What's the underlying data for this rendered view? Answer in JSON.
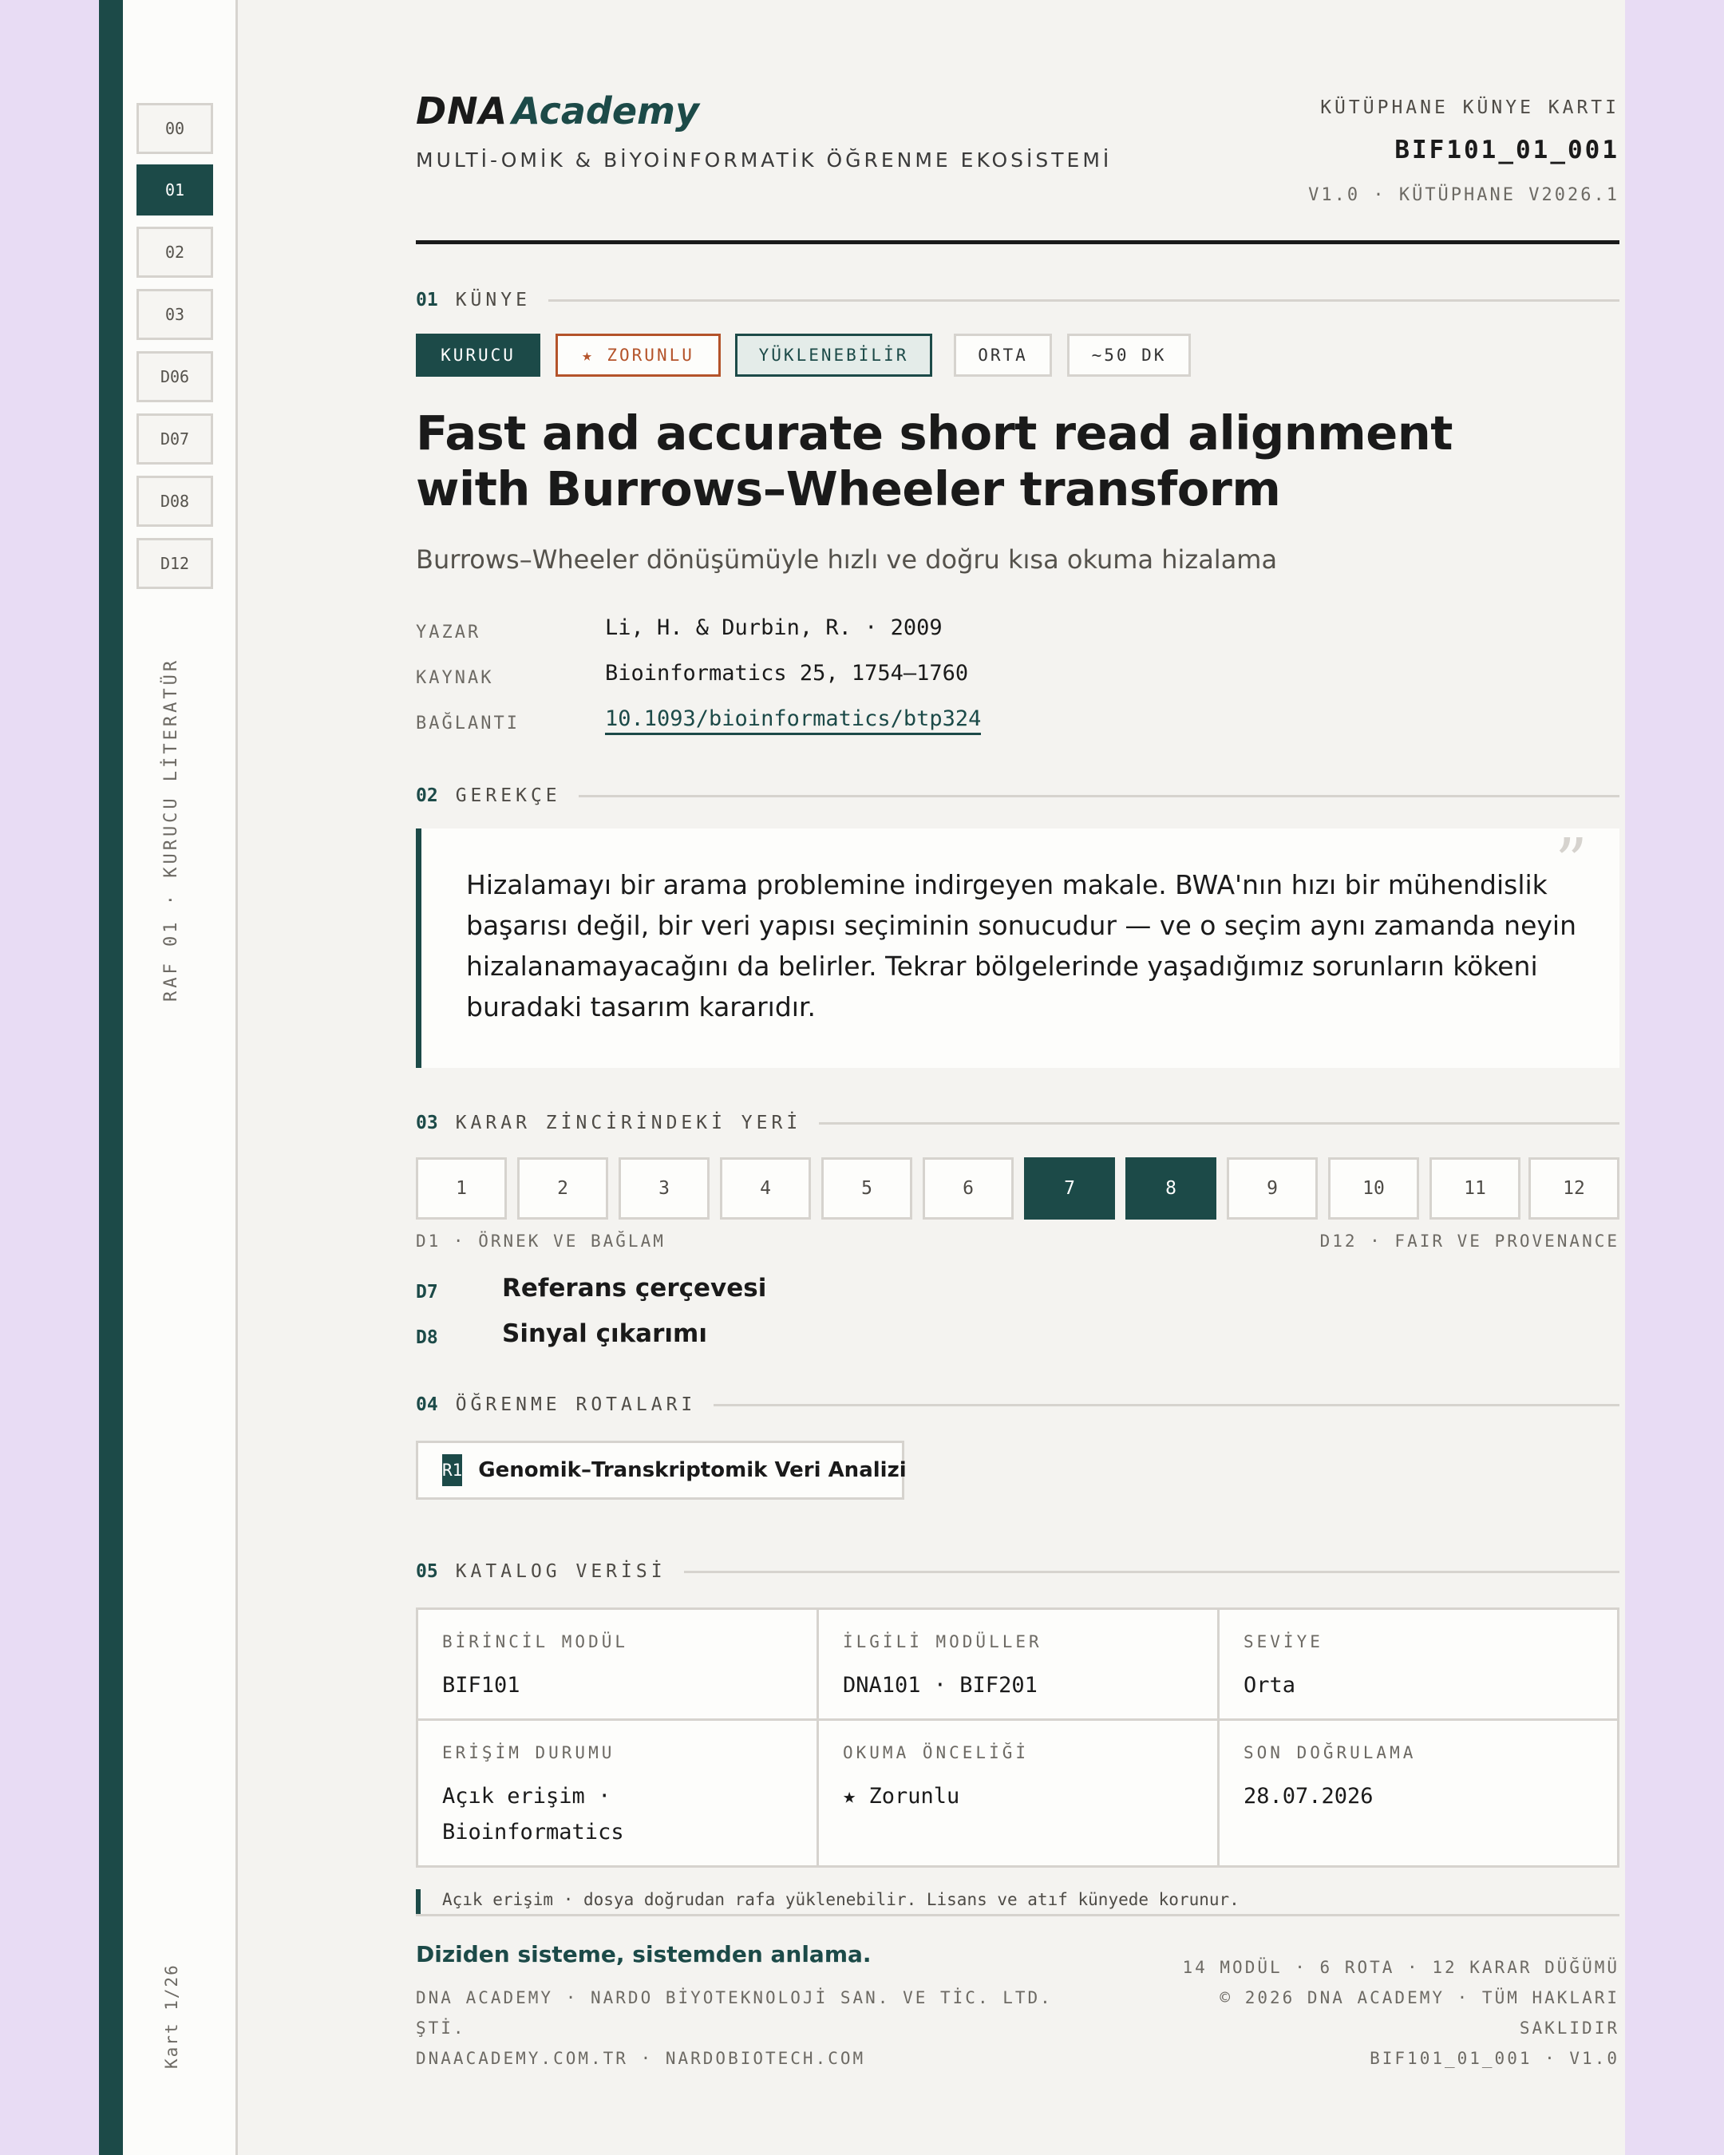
{
  "rail": {
    "items": [
      "00",
      "01",
      "02",
      "03",
      "D06",
      "D07",
      "D08",
      "D12"
    ],
    "active_index": 1,
    "shelf_label": "RAF 01 · KURUCU LİTERATÜR",
    "card_label": "Kart 1/26"
  },
  "header": {
    "brand_dna": "DNA",
    "brand_academy": "Academy",
    "tagline": "MULTİ-OMİK & BİYOİNFORMATİK ÖĞRENME EKOSİSTEMİ",
    "card_type": "KÜTÜPHANE KÜNYE KARTI",
    "card_id": "BIF101_01_001",
    "version": "V1.0 · KÜTÜPHANE V2026.1"
  },
  "sections": {
    "s1": {
      "num": "01",
      "label": "KÜNYE"
    },
    "s2": {
      "num": "02",
      "label": "GEREKÇE"
    },
    "s3": {
      "num": "03",
      "label": "KARAR ZİNCİRİNDEKİ YERİ"
    },
    "s4": {
      "num": "04",
      "label": "ÖĞRENME ROTALARI"
    },
    "s5": {
      "num": "05",
      "label": "KATALOG VERİSİ"
    }
  },
  "tags": [
    "KURUCU",
    "★ ZORUNLU",
    "YÜKLENEBİLİR",
    "ORTA",
    "~50 DK"
  ],
  "colors": {
    "accent": "#1c4a48",
    "warning": "#b4532a",
    "background": "#e8dcf4"
  },
  "paper": {
    "title_line1": "Fast and accurate short read alignment",
    "title_line2": "with Burrows–Wheeler transform",
    "subtitle": "Burrows–Wheeler dönüşümüyle hızlı ve doğru kısa okuma hizalama",
    "meta": [
      {
        "key": "YAZAR",
        "value": "Li, H. & Durbin, R. · 2009"
      },
      {
        "key": "KAYNAK",
        "value": "Bioinformatics 25, 1754–1760"
      },
      {
        "key": "BAĞLANTI",
        "value": "10.1093/bioinformatics/btp324"
      }
    ]
  },
  "rationale": {
    "quote_mark": "”",
    "text": "Hizalamayı bir arama problemine indirgeyen makale. BWA'nın hızı bir mühendislik başarısı değil, bir veri yapısı seçiminin sonucudur — ve o seçim aynı zamanda neyin hizalanamayacağını da belirler. Tekrar bölgelerinde yaşadığımız sorunların kökeni buradaki tasarım kararıdır."
  },
  "chain": {
    "steps": [
      "1",
      "2",
      "3",
      "4",
      "5",
      "6",
      "7",
      "8",
      "9",
      "10",
      "11",
      "12"
    ],
    "active": [
      "7",
      "8"
    ],
    "start_label": "D1 · ÖRNEK VE BAĞLAM",
    "end_label": "D12 · FAIR VE PROVENANCE",
    "decisions": [
      {
        "code": "D7",
        "name": "Referans çerçevesi"
      },
      {
        "code": "D8",
        "name": "Sinyal çıkarımı"
      }
    ]
  },
  "routes": [
    {
      "code": "R1",
      "name": "Genomik–Transkriptomik Veri Analizi"
    }
  ],
  "catalog": {
    "cells": [
      {
        "key": "BİRİNCİL MODÜL",
        "value": "BIF101"
      },
      {
        "key": "İLGİLİ MODÜLLER",
        "value": "DNA101 · BIF201"
      },
      {
        "key": "SEVİYE",
        "value": "Orta"
      },
      {
        "key": "ERİŞİM DURUMU",
        "value": "Açık erişim · Bioinformatics"
      },
      {
        "key": "OKUMA ÖNCELİĞİ",
        "value": "★ Zorunlu"
      },
      {
        "key": "SON DOĞRULAMA",
        "value": "28.07.2026"
      }
    ],
    "note": "Açık erişim · dosya doğrudan rafa yüklenebilir. Lisans ve atıf künyede korunur."
  },
  "footer": {
    "slogan": "Diziden sisteme, sistemden anlama.",
    "company": "DNA ACADEMY · NARDO BİYOTEKNOLOJİ SAN. VE TİC. LTD. ŞTİ.",
    "websites": "DNAACADEMY.COM.TR · NARDOBIOTECH.COM",
    "stats": "14 MODÜL · 6 ROTA · 12 KARAR DÜĞÜMÜ",
    "copyright": "© 2026 DNA ACADEMY · TÜM HAKLARI SAKLIDIR",
    "doc_id": "BIF101_01_001 · V1.0"
  }
}
